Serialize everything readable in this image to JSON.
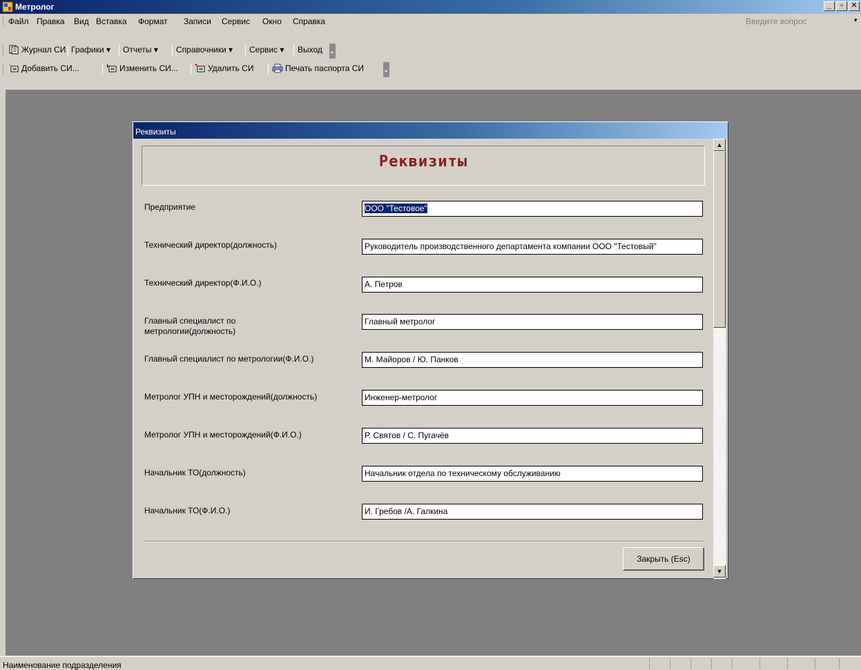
{
  "window": {
    "title": "Метролог"
  },
  "menubar": {
    "items": [
      "Файл",
      "Правка",
      "Вид",
      "Вставка",
      "Формат",
      "Записи",
      "Сервис",
      "Окно",
      "Справка"
    ],
    "ask_placeholder": "Введите вопрос"
  },
  "toolbar1": {
    "items": [
      "Журнал СИ",
      "Графики ▾",
      "Отчеты ▾",
      "Справочники ▾",
      "Сервис ▾",
      "Выход"
    ]
  },
  "toolbar2": {
    "items": [
      "Добавить СИ...",
      "Изменить СИ...",
      "Удалить СИ",
      "Печать паспорта СИ"
    ]
  },
  "dialog": {
    "title": "Реквизиты",
    "header": "Реквизиты",
    "close_label": "Закрыть (Esc)",
    "fields": [
      {
        "label": "Предприятие",
        "value": "ООО \"Тестовое\""
      },
      {
        "label": "Технический директор(должность)",
        "value": "Руководитель производственного департамента компании ООО \"Тестовый\""
      },
      {
        "label": "Технический директор(Ф.И.О.)",
        "value": "А. Петров"
      },
      {
        "label": "Главный специалист по метрологии(должность)",
        "value": "Главный метролог"
      },
      {
        "label": "Главный специалист по метрологии(Ф.И.О.)",
        "value": "М. Майоров / Ю. Панков"
      },
      {
        "label": "Метролог УПН и месторождений(должность)",
        "value": "Инженер-метролог"
      },
      {
        "label": "Метролог УПН и месторождений(Ф.И.О.)",
        "value": "Р. Святов / С. Пугачёв"
      },
      {
        "label": "Начальник ТО(должность)",
        "value": "Начальник отдела по техническому обслуживанию"
      },
      {
        "label": "Начальник ТО(Ф.И.О.)",
        "value": "И. Гребов /А. Галкина"
      }
    ]
  },
  "statusbar": {
    "text": "Наименование подразделения"
  }
}
